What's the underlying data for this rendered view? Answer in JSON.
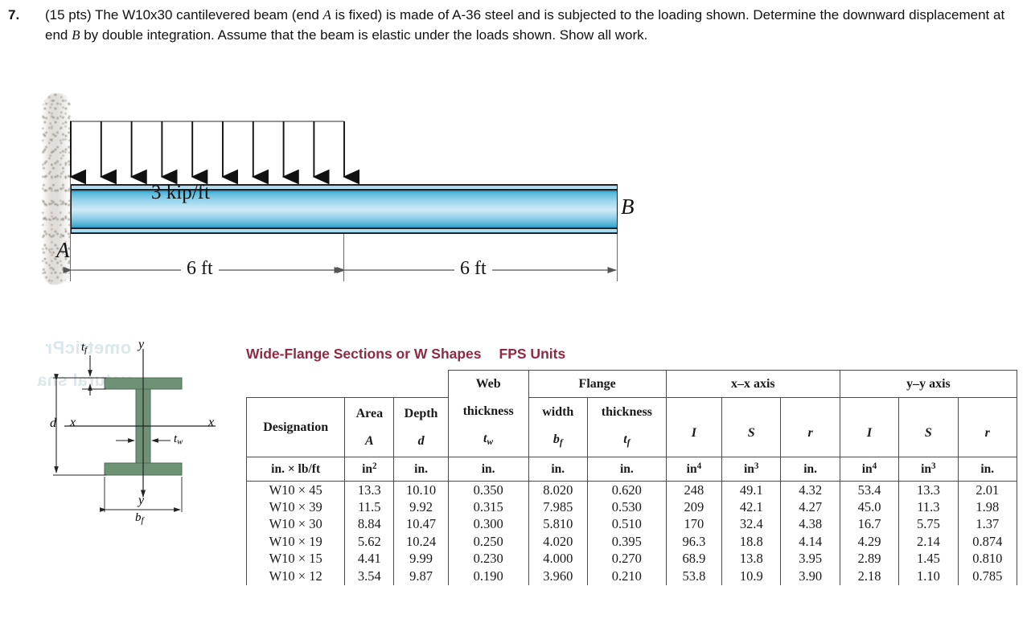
{
  "problem": {
    "number": "7.",
    "points": "(15 pts)",
    "line1_a": "(15 pts) The W10x30 cantilevered beam (end ",
    "symbol_A": "A",
    "line1_b": " is fixed) is made of A-36 steel and is subjected to the loading shown. Determine the downward displacement at end ",
    "symbol_B": "B",
    "line1_c": " by double integration.  Assume that the beam is elastic under the loads shown. Show all work."
  },
  "beam_figure": {
    "load_label": "3 kip/ft",
    "support_label_A": "A",
    "free_end_label_B": "B",
    "dimension_left": "6 ft",
    "dimension_right": "6 ft",
    "arrow_count": 10,
    "support_type": "fixed-wall-hatching"
  },
  "section_figure": {
    "label_d": "d",
    "label_tf": "tf",
    "label_tw": "tw",
    "label_bf": "bf",
    "axis_x_left": "x",
    "axis_x_right": "x",
    "axis_y_top": "y",
    "axis_y_bottom": "y",
    "flange_color": "#6f9276",
    "ghost_line1": "ometricPr",
    "ghost_line2": "uctural sha"
  },
  "table": {
    "title": "Wide-Flange Sections or W Shapes",
    "units_system": "FPS Units",
    "group_headers": [
      {
        "label": "Web",
        "span": 1
      },
      {
        "label": "Flange",
        "span": 2
      },
      {
        "label": "x–x axis",
        "span": 3
      },
      {
        "label": "y–y axis",
        "span": 3
      }
    ],
    "columns": [
      {
        "name": "Designation",
        "symbol": "",
        "unit": "in. × lb/ft"
      },
      {
        "name": "Area",
        "symbol": "A",
        "unit": "in²"
      },
      {
        "name": "Depth",
        "symbol": "d",
        "unit": "in."
      },
      {
        "name": "thickness",
        "symbol": "tw",
        "unit": "in."
      },
      {
        "name": "width",
        "symbol": "bf",
        "unit": "in."
      },
      {
        "name": "thickness",
        "symbol": "tf",
        "unit": "in."
      },
      {
        "name": "",
        "symbol": "I",
        "unit": "in⁴"
      },
      {
        "name": "",
        "symbol": "S",
        "unit": "in³"
      },
      {
        "name": "",
        "symbol": "r",
        "unit": "in."
      },
      {
        "name": "",
        "symbol": "I",
        "unit": "in⁴"
      },
      {
        "name": "",
        "symbol": "S",
        "unit": "in³"
      },
      {
        "name": "",
        "symbol": "r",
        "unit": "in."
      }
    ],
    "rows": [
      [
        "W10 × 45",
        "13.3",
        "10.10",
        "0.350",
        "8.020",
        "0.620",
        "248",
        "49.1",
        "4.32",
        "53.4",
        "13.3",
        "2.01"
      ],
      [
        "W10 × 39",
        "11.5",
        "9.92",
        "0.315",
        "7.985",
        "0.530",
        "209",
        "42.1",
        "4.27",
        "45.0",
        "11.3",
        "1.98"
      ],
      [
        "W10 × 30",
        "8.84",
        "10.47",
        "0.300",
        "5.810",
        "0.510",
        "170",
        "32.4",
        "4.38",
        "16.7",
        "5.75",
        "1.37"
      ],
      [
        "W10 × 19",
        "5.62",
        "10.24",
        "0.250",
        "4.020",
        "0.395",
        "96.3",
        "18.8",
        "4.14",
        "4.29",
        "2.14",
        "0.874"
      ],
      [
        "W10 × 15",
        "4.41",
        "9.99",
        "0.230",
        "4.000",
        "0.270",
        "68.9",
        "13.8",
        "3.95",
        "2.89",
        "1.45",
        "0.810"
      ],
      [
        "W10 × 12",
        "3.54",
        "9.87",
        "0.190",
        "3.960",
        "0.210",
        "53.8",
        "10.9",
        "3.90",
        "2.18",
        "1.10",
        "0.785"
      ]
    ]
  },
  "colors": {
    "title_maroon": "#8e2a41",
    "beam_blue": "#54b6da",
    "flange_green": "#6f9276",
    "ink": "#111111"
  }
}
